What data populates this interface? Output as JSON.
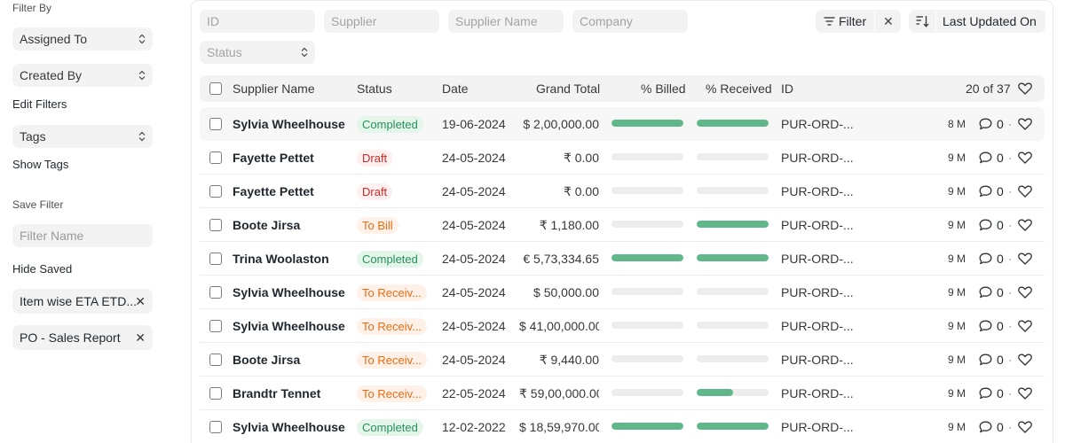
{
  "sidebar": {
    "filter_by": "Filter By",
    "assigned_to": "Assigned To",
    "created_by": "Created By",
    "edit_filters": "Edit Filters",
    "tags": "Tags",
    "show_tags": "Show Tags",
    "save_filter": "Save Filter",
    "filter_name_placeholder": "Filter Name",
    "hide_saved": "Hide Saved",
    "saved_filters": [
      "Item wise ETA ETD...",
      "PO - Sales Report"
    ]
  },
  "filters": {
    "id": "ID",
    "supplier": "Supplier",
    "supplier_name": "Supplier Name",
    "company": "Company",
    "status": "Status"
  },
  "toolbar": {
    "filter_label": "Filter",
    "sort_label": "Last Updated On"
  },
  "table": {
    "headers": {
      "supplier_name": "Supplier Name",
      "status": "Status",
      "date": "Date",
      "grand_total": "Grand Total",
      "billed": "% Billed",
      "received": "% Received",
      "id": "ID",
      "count": "20 of 37"
    },
    "rows": [
      {
        "name": "Sylvia Wheelhouse",
        "status": "Completed",
        "color": "green",
        "date": "19-06-2024",
        "total": "$ 2,00,000.00",
        "billed": 100,
        "received": 100,
        "id": "PUR-ORD-...",
        "modified": "8 M",
        "comments": "0"
      },
      {
        "name": "Fayette Pettet",
        "status": "Draft",
        "color": "red",
        "date": "24-05-2024",
        "total": "₹ 0.00",
        "billed": 0,
        "received": 0,
        "id": "PUR-ORD-...",
        "modified": "9 M",
        "comments": "0"
      },
      {
        "name": "Fayette Pettet",
        "status": "Draft",
        "color": "red",
        "date": "24-05-2024",
        "total": "₹ 0.00",
        "billed": 0,
        "received": 0,
        "id": "PUR-ORD-...",
        "modified": "9 M",
        "comments": "0"
      },
      {
        "name": "Boote Jirsa",
        "status": "To Bill",
        "color": "orange",
        "date": "24-05-2024",
        "total": "₹ 1,180.00",
        "billed": 0,
        "received": 100,
        "id": "PUR-ORD-...",
        "modified": "9 M",
        "comments": "0"
      },
      {
        "name": "Trina Woolaston",
        "status": "Completed",
        "color": "green",
        "date": "24-05-2024",
        "total": "€ 5,73,334.65",
        "billed": 100,
        "received": 100,
        "id": "PUR-ORD-...",
        "modified": "9 M",
        "comments": "0"
      },
      {
        "name": "Sylvia Wheelhouse",
        "status": "To Receiv...",
        "color": "orange",
        "date": "24-05-2024",
        "total": "$ 50,000.00",
        "billed": 0,
        "received": 0,
        "id": "PUR-ORD-...",
        "modified": "9 M",
        "comments": "0"
      },
      {
        "name": "Sylvia Wheelhouse",
        "status": "To Receiv...",
        "color": "orange",
        "date": "24-05-2024",
        "total": "$ 41,00,000.00",
        "billed": 0,
        "received": 0,
        "id": "PUR-ORD-...",
        "modified": "9 M",
        "comments": "0"
      },
      {
        "name": "Boote Jirsa",
        "status": "To Receiv...",
        "color": "orange",
        "date": "24-05-2024",
        "total": "₹ 9,440.00",
        "billed": 0,
        "received": 0,
        "id": "PUR-ORD-...",
        "modified": "9 M",
        "comments": "0"
      },
      {
        "name": "Brandtr Tennet",
        "status": "To Receiv...",
        "color": "orange",
        "date": "22-05-2024",
        "total": "₹ 59,00,000.00",
        "billed": 0,
        "received": 50,
        "id": "PUR-ORD-...",
        "modified": "9 M",
        "comments": "0"
      },
      {
        "name": "Sylvia Wheelhouse",
        "status": "Completed",
        "color": "green",
        "date": "12-02-2022",
        "total": "$ 18,59,970.00",
        "billed": 100,
        "received": 100,
        "id": "PUR-ORD-...",
        "modified": "9 M",
        "comments": "0"
      }
    ]
  },
  "icons": {
    "filter": "filter-lines-icon",
    "close": "close-icon",
    "sort": "sort-descending-icon",
    "heart": "heart-icon",
    "comment": "comment-icon",
    "chevron": "chevron-up-down-icon"
  },
  "colors": {
    "progress_fill": "#5fb78a",
    "completed": "#278f5e",
    "draft": "#cc2929",
    "pending": "#e86c13"
  }
}
